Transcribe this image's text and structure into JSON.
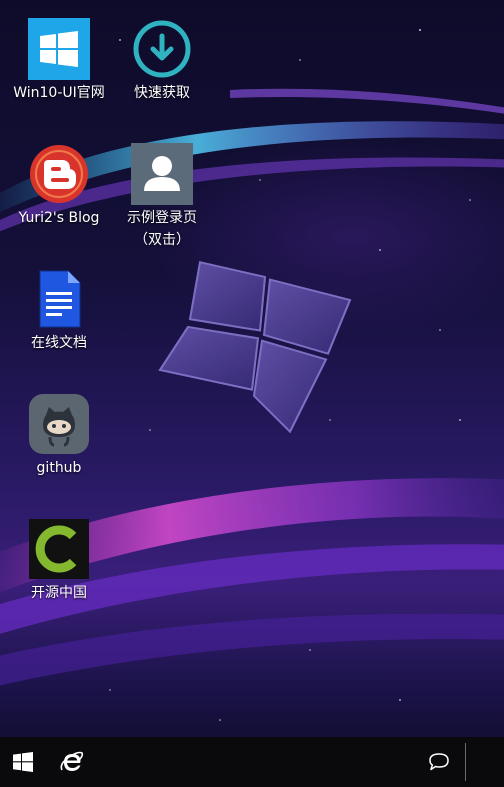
{
  "desktop": {
    "icons": [
      {
        "id": "win10-ui",
        "label": "Win10-UI官网",
        "icon": "windows-logo-icon",
        "color": "#1fa6e8"
      },
      {
        "id": "quick-get",
        "label": "快速获取",
        "icon": "download-icon",
        "color": "#2fb3c0"
      },
      {
        "id": "blog",
        "label": "Yuri2's Blog",
        "icon": "blogger-icon",
        "color": "#d9342b"
      },
      {
        "id": "login",
        "label": "示例登录页\n（双击）",
        "icon": "user-icon",
        "color": "#5b6b7a"
      },
      {
        "id": "docs",
        "label": "在线文档",
        "icon": "document-icon",
        "color": "#1f57e0"
      },
      {
        "id": "github",
        "label": "github",
        "icon": "github-icon",
        "color": "#5c6670"
      },
      {
        "id": "oschina",
        "label": "开源中国",
        "icon": "oschina-icon",
        "color": "#84b82f"
      }
    ]
  },
  "taskbar": {
    "start": "windows-start-icon",
    "browser": "ie-browser-icon",
    "notifications": "message-icon"
  }
}
